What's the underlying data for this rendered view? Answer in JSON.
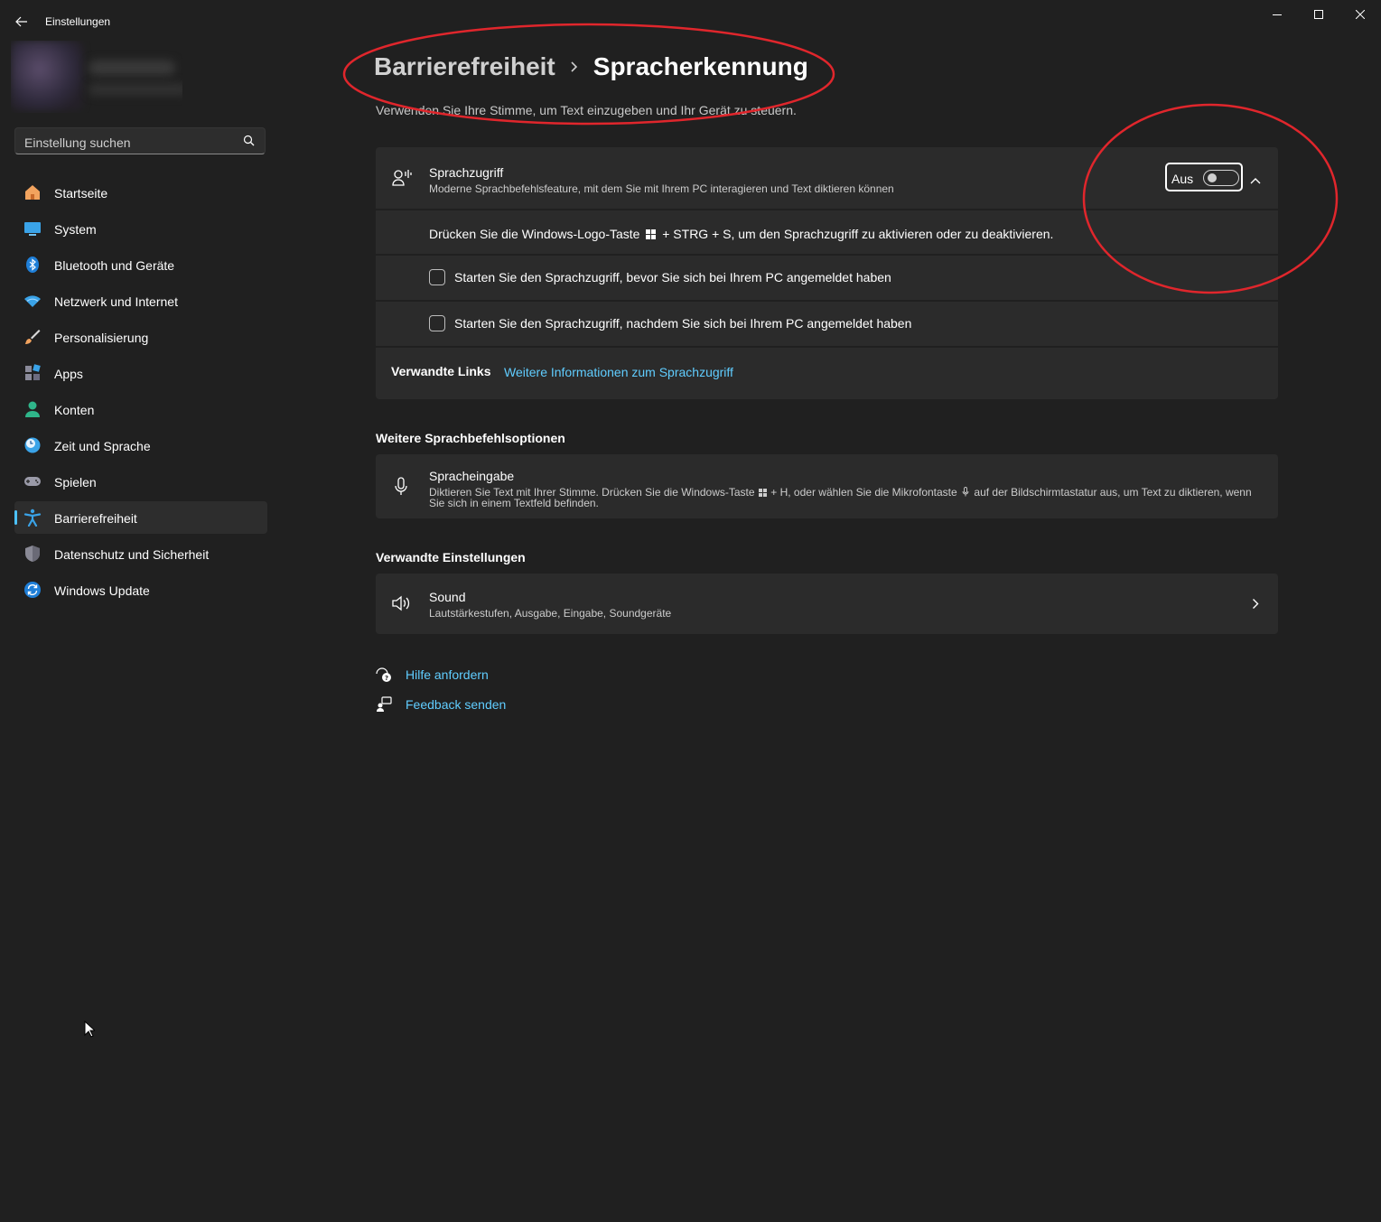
{
  "window": {
    "title": "Einstellungen",
    "controls": [
      "minimize",
      "maximize",
      "close"
    ]
  },
  "search": {
    "placeholder": "Einstellung suchen"
  },
  "sidebar": {
    "items": [
      {
        "label": "Startseite",
        "icon": "home-icon"
      },
      {
        "label": "System",
        "icon": "monitor-icon"
      },
      {
        "label": "Bluetooth und Geräte",
        "icon": "bluetooth-icon"
      },
      {
        "label": "Netzwerk und Internet",
        "icon": "wifi-icon"
      },
      {
        "label": "Personalisierung",
        "icon": "brush-icon"
      },
      {
        "label": "Apps",
        "icon": "apps-icon"
      },
      {
        "label": "Konten",
        "icon": "account-icon"
      },
      {
        "label": "Zeit und Sprache",
        "icon": "clock-globe-icon"
      },
      {
        "label": "Spielen",
        "icon": "gamepad-icon"
      },
      {
        "label": "Barrierefreiheit",
        "icon": "accessibility-icon",
        "active": true
      },
      {
        "label": "Datenschutz und Sicherheit",
        "icon": "shield-icon"
      },
      {
        "label": "Windows Update",
        "icon": "update-icon"
      }
    ]
  },
  "breadcrumb": {
    "parent": "Barrierefreiheit",
    "current": "Spracherkennung"
  },
  "subtitle": "Verwenden Sie Ihre Stimme, um Text einzugeben und Ihr Gerät zu steuern.",
  "voice_access": {
    "title": "Sprachzugriff",
    "description": "Moderne Sprachbefehlsfeature, mit dem Sie mit Ihrem PC interagieren und Text diktieren können",
    "toggle_label": "Aus",
    "toggle_on": false,
    "shortcut_pre": "Drücken Sie die Windows-Logo-Taste",
    "shortcut_post": "+ STRG + S, um den Sprachzugriff zu aktivieren oder zu deaktivieren.",
    "options": [
      {
        "label": "Starten Sie den Sprachzugriff, bevor Sie sich bei Ihrem PC angemeldet haben",
        "checked": false
      },
      {
        "label": "Starten Sie den Sprachzugriff, nachdem Sie sich bei Ihrem PC angemeldet haben",
        "checked": false
      }
    ],
    "related_links_label": "Verwandte Links",
    "related_link": "Weitere Informationen zum Sprachzugriff"
  },
  "more_options": {
    "heading": "Weitere Sprachbefehlsoptionen",
    "voice_typing": {
      "title": "Spracheingabe",
      "desc_part1": "Diktieren Sie Text mit Ihrer Stimme. Drücken Sie die Windows-Taste",
      "desc_part2": "+ H, oder wählen Sie die Mikrofontaste",
      "desc_part3": "auf der Bildschirmtastatur aus, um Text zu diktieren, wenn",
      "desc_line2": "Sie sich in einem Textfeld befinden."
    }
  },
  "related_settings": {
    "heading": "Verwandte Einstellungen",
    "sound": {
      "title": "Sound",
      "description": "Lautstärkestufen, Ausgabe, Eingabe, Soundgeräte"
    }
  },
  "footer_links": {
    "help": "Hilfe anfordern",
    "feedback": "Feedback senden"
  },
  "colors": {
    "background": "#202020",
    "card": "#2b2b2b",
    "accent": "#60cdff",
    "indicator": "#4cc2ff",
    "annotation": "#e0262c"
  }
}
